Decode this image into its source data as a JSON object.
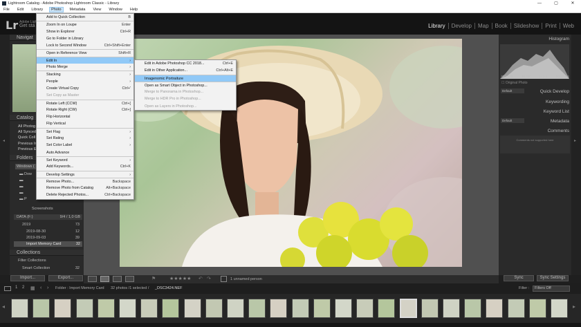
{
  "window": {
    "title": "Lightroom Catalog - Adobe Photoshop Lightroom Classic - Library",
    "controls": [
      "—",
      "▢",
      "✕"
    ]
  },
  "menubar": [
    "File",
    "Edit",
    "Library",
    "Photo",
    "Metadata",
    "View",
    "Window",
    "Help"
  ],
  "identity": {
    "logo": "Lr",
    "line1": "Adobe Light",
    "line2": "Get sta"
  },
  "modules": [
    "Library",
    "Develop",
    "Map",
    "Book",
    "Slideshow",
    "Print",
    "Web"
  ],
  "photo_menu": [
    {
      "label": "Add to Quick Collection",
      "shortcut": "B"
    },
    {
      "label": "Zoom In on Loupe",
      "shortcut": "Enter",
      "sep": true
    },
    {
      "label": "Show in Explorer",
      "shortcut": "Ctrl+R"
    },
    {
      "label": "Go to Folder in Library",
      "shortcut": ""
    },
    {
      "label": "Lock to Second Window",
      "shortcut": "Ctrl+Shift+Enter"
    },
    {
      "label": "Open in Reference View",
      "shortcut": "Shift+R",
      "sep": true
    },
    {
      "label": "Edit In",
      "shortcut": "›",
      "sep": true,
      "hl": true
    },
    {
      "label": "Photo Merge",
      "shortcut": "›"
    },
    {
      "label": "Stacking",
      "shortcut": "›",
      "sep": true
    },
    {
      "label": "People",
      "shortcut": "›"
    },
    {
      "label": "Create Virtual Copy",
      "shortcut": "Ctrl+'"
    },
    {
      "label": "Set Copy as Master",
      "shortcut": "",
      "dis": true
    },
    {
      "label": "Rotate Left (CCW)",
      "shortcut": "Ctrl+[",
      "sep": true
    },
    {
      "label": "Rotate Right (CW)",
      "shortcut": "Ctrl+]"
    },
    {
      "label": "Flip Horizontal",
      "shortcut": ""
    },
    {
      "label": "Flip Vertical",
      "shortcut": ""
    },
    {
      "label": "Set Flag",
      "shortcut": "›",
      "sep": true
    },
    {
      "label": "Set Rating",
      "shortcut": "›"
    },
    {
      "label": "Set Color Label",
      "shortcut": "›"
    },
    {
      "label": "Auto Advance",
      "shortcut": ""
    },
    {
      "label": "Set Keyword",
      "shortcut": "›",
      "sep": true
    },
    {
      "label": "Add Keywords...",
      "shortcut": "Ctrl+K"
    },
    {
      "label": "Develop Settings",
      "shortcut": "›",
      "sep": true
    },
    {
      "label": "Remove Photo...",
      "shortcut": "Backspace",
      "sep": true
    },
    {
      "label": "Remove Photo from Catalog",
      "shortcut": "Alt+Backspace"
    },
    {
      "label": "Delete Rejected Photos...",
      "shortcut": "Ctrl+Backspace"
    }
  ],
  "editin_menu": [
    {
      "label": "Edit in Adobe Photoshop CC 2018...",
      "shortcut": "Ctrl+E"
    },
    {
      "label": "Edit in Other Application...",
      "shortcut": "Ctrl+Alt+E"
    },
    {
      "label": "Imagenomic Portraiture",
      "shortcut": "",
      "sep": true,
      "hl": true
    },
    {
      "label": "Open as Smart Object in Photoshop...",
      "shortcut": "",
      "sep": true
    },
    {
      "label": "Merge to Panorama in Photoshop...",
      "shortcut": "",
      "dis": true
    },
    {
      "label": "Merge to HDR Pro in Photoshop...",
      "shortcut": "",
      "dis": true
    },
    {
      "label": "Open as Layers in Photoshop...",
      "shortcut": "",
      "dis": true
    }
  ],
  "left": {
    "navigator": "Navigat",
    "catalog": "Catalog",
    "catalog_items": [
      "All Photog",
      "All Synced",
      "Quick Coll",
      "Previous Im",
      "Previous Ex"
    ],
    "folders": "Folders",
    "volume": "Windows (",
    "subfolders": [
      "Dow",
      "",
      "",
      "",
      "",
      ""
    ],
    "pictures": "P",
    "screenshots": "Screenshots",
    "data_drive": "DATA (F:)",
    "data_drive_info": "9/4 / 1,0 GB",
    "year": "2019",
    "year_count": "73",
    "dates": [
      {
        "label": "2019-08-30",
        "count": "12"
      },
      {
        "label": "2019-09-03",
        "count": "39"
      }
    ],
    "import_folder": "Import Memory Card",
    "import_count": "32",
    "collections": "Collections",
    "filter_collections": "Filter Collections",
    "smart_collection": "Smart Collection",
    "smart_count": "32",
    "import_btn": "Import...",
    "export_btn": "Export..."
  },
  "right": {
    "histogram": "Histogram",
    "histo_values": [
      "ISO 125",
      "30 mm",
      "f / 2.8",
      "1/250 sec"
    ],
    "original_photo": "Original Photo",
    "default1": "Default",
    "quick_develop": "Quick Develop",
    "keywording": "Keywording",
    "keyword_list": "Keyword List",
    "default2": "Default",
    "metadata": "Metadata",
    "comments": "Comments",
    "comments_note": "Comments not supported here",
    "sync_btn": "Sync",
    "sync_settings_btn": "Sync Settings"
  },
  "toolbar": {
    "people": "1 unnamed person"
  },
  "filmstrip_header": {
    "pages": [
      "1",
      "2"
    ],
    "source": "Folder : Import Memory Card",
    "count": "32 photos /1 selected /",
    "filename": "_DSC3424.NEF",
    "filter_label": "Filter :",
    "filter_value": "Filters Off"
  },
  "colors": {
    "accent": "#91c9f7",
    "bg": "#1f1f1f",
    "panel": "#2a2a2a"
  }
}
